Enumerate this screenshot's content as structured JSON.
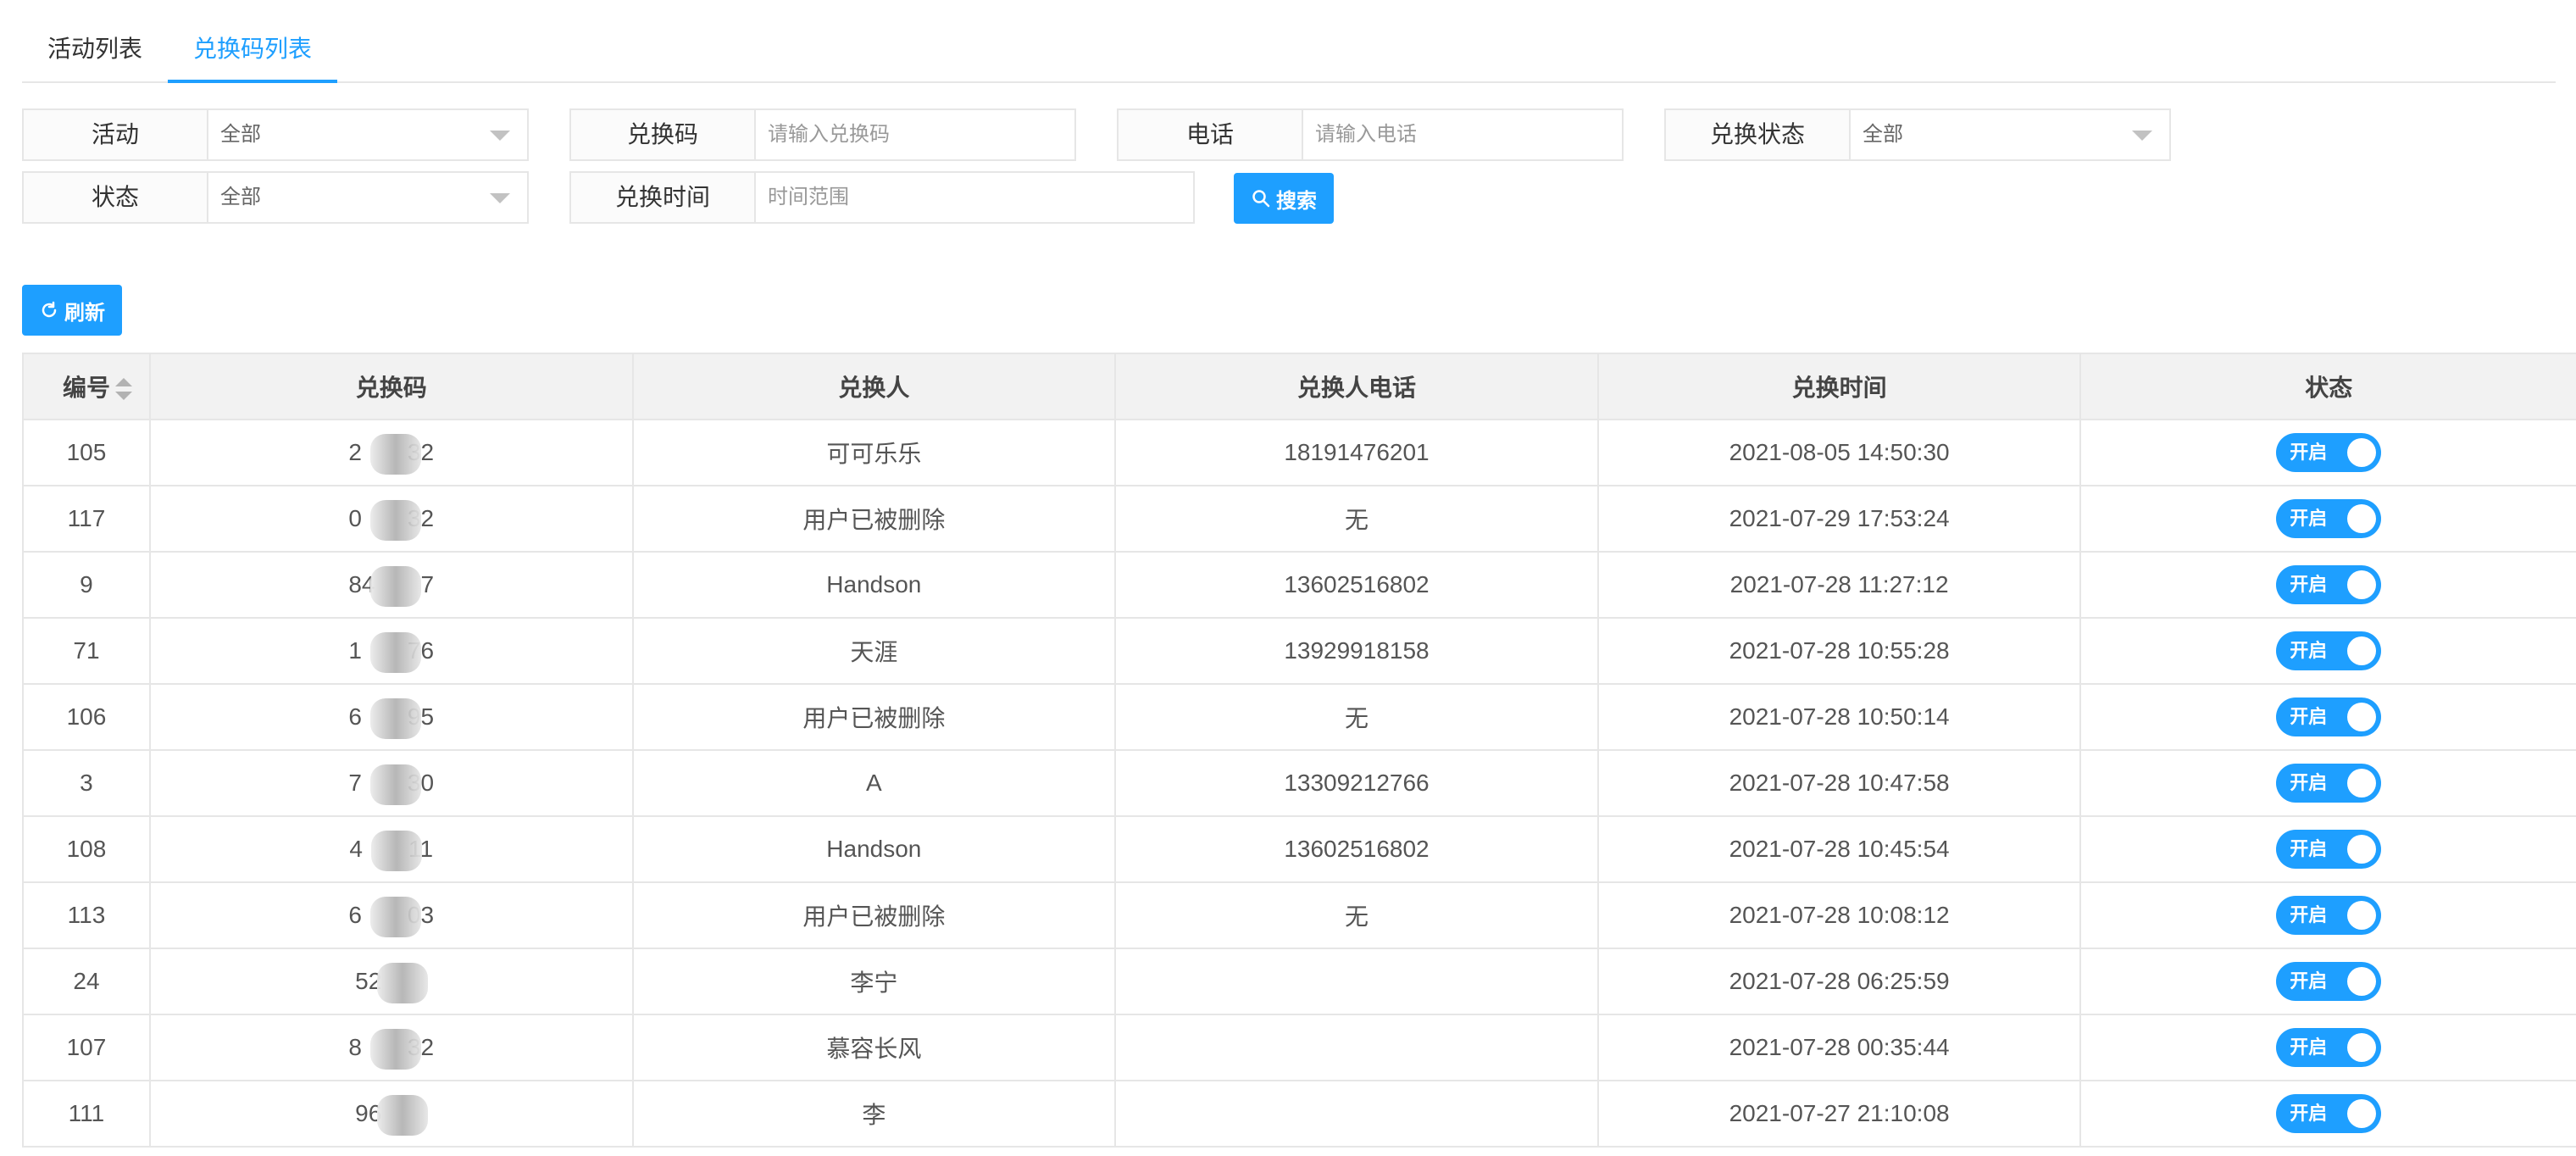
{
  "tabs": [
    {
      "label": "活动列表",
      "active": false
    },
    {
      "label": "兑换码列表",
      "active": true
    }
  ],
  "filters": {
    "activity": {
      "label": "活动",
      "value": "全部"
    },
    "code": {
      "label": "兑换码",
      "placeholder": "请输入兑换码"
    },
    "phone": {
      "label": "电话",
      "placeholder": "请输入电话"
    },
    "redeem_status": {
      "label": "兑换状态",
      "value": "全部"
    },
    "status": {
      "label": "状态",
      "value": "全部"
    },
    "redeem_time": {
      "label": "兑换时间",
      "placeholder": "时间范围"
    },
    "search_label": "搜索"
  },
  "toolbar": {
    "refresh_label": "刷新"
  },
  "colors": {
    "accent": "#1e9fff",
    "border": "#e6e6e6",
    "header_bg": "#f2f2f2"
  },
  "table": {
    "columns": [
      "编号",
      "兑换码",
      "兑换人",
      "兑换人电话",
      "兑换时间",
      "状态"
    ],
    "rows": [
      {
        "id": "105",
        "code_start": "2",
        "code_end": "32",
        "name": "可可乐乐",
        "phone": "18191476201",
        "time": "2021-08-05 14:50:30",
        "status": "开启"
      },
      {
        "id": "117",
        "code_start": "0",
        "code_end": "32",
        "name": "用户已被删除",
        "phone": "无",
        "time": "2021-07-29 17:53:24",
        "status": "开启"
      },
      {
        "id": "9",
        "code_start": "84",
        "code_end": "7",
        "name": "Handson",
        "phone": "13602516802",
        "time": "2021-07-28 11:27:12",
        "status": "开启"
      },
      {
        "id": "71",
        "code_start": "1",
        "code_end": "76",
        "name": "天涯",
        "phone": "13929918158",
        "time": "2021-07-28 10:55:28",
        "status": "开启"
      },
      {
        "id": "106",
        "code_start": "6",
        "code_end": "95",
        "name": "用户已被删除",
        "phone": "无",
        "time": "2021-07-28 10:50:14",
        "status": "开启"
      },
      {
        "id": "3",
        "code_start": "7",
        "code_end": "30",
        "name": "A",
        "phone": "13309212766",
        "time": "2021-07-28 10:47:58",
        "status": "开启"
      },
      {
        "id": "108",
        "code_start": "4",
        "code_end": "11",
        "name": "Handson",
        "phone": "13602516802",
        "time": "2021-07-28 10:45:54",
        "status": "开启"
      },
      {
        "id": "113",
        "code_start": "6",
        "code_end": "03",
        "name": "用户已被删除",
        "phone": "无",
        "time": "2021-07-28 10:08:12",
        "status": "开启"
      },
      {
        "id": "24",
        "code_start": "52",
        "code_end": "",
        "name": "李宁",
        "phone": "",
        "time": "2021-07-28 06:25:59",
        "status": "开启"
      },
      {
        "id": "107",
        "code_start": "8",
        "code_end": "32",
        "name": "慕容长风",
        "phone": "",
        "time": "2021-07-28 00:35:44",
        "status": "开启"
      },
      {
        "id": "111",
        "code_start": "96",
        "code_end": "",
        "name": "李",
        "phone": "",
        "time": "2021-07-27 21:10:08",
        "status": "开启"
      }
    ]
  }
}
